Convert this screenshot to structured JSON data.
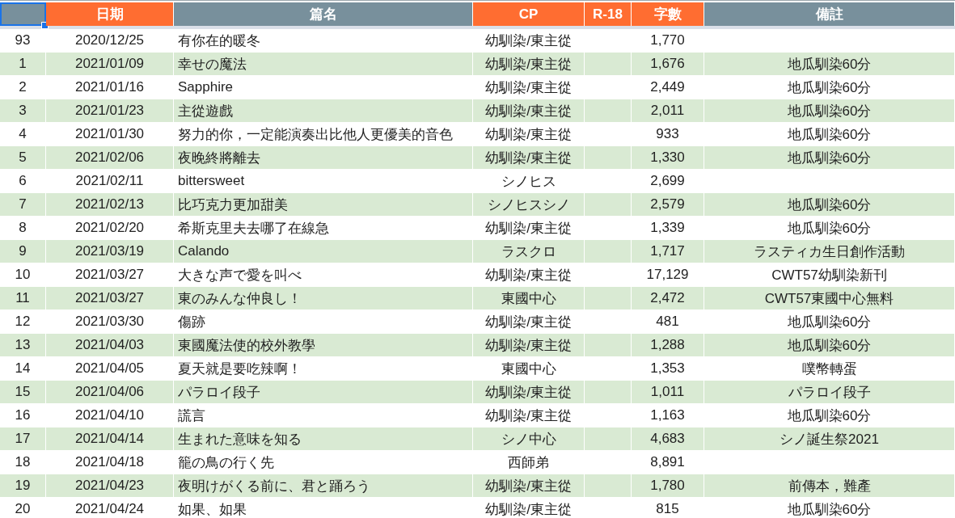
{
  "columns": [
    {
      "color": "#78909c",
      "selected": true
    },
    {
      "label": "日期",
      "color": "#ff6d31",
      "selected": false
    },
    {
      "label": "篇名",
      "color": "#78909c",
      "selected": false
    },
    {
      "label": "CP",
      "color": "#ff6d31",
      "selected": false
    },
    {
      "label": "R-18",
      "color": "#ff6d31",
      "selected": false
    },
    {
      "label": "字數",
      "color": "#ff6d31",
      "selected": false
    },
    {
      "label": "備註",
      "color": "#78909c",
      "selected": false
    }
  ],
  "rows": [
    {
      "no": "93",
      "date": "2020/12/25",
      "title": "有你在的暖冬",
      "cp": "幼馴染/東主從",
      "words": "1,770"
    },
    {
      "no": "1",
      "date": "2021/01/09",
      "title": "幸せの魔法",
      "cp": "幼馴染/東主從",
      "words": "1,676",
      "note": "地瓜馴染60分"
    },
    {
      "no": "2",
      "date": "2021/01/16",
      "title": "Sapphire",
      "cp": "幼馴染/東主從",
      "words": "2,449",
      "note": "地瓜馴染60分"
    },
    {
      "no": "3",
      "date": "2021/01/23",
      "title": "主從遊戲",
      "cp": "幼馴染/東主從",
      "words": "2,011",
      "note": "地瓜馴染60分"
    },
    {
      "no": "4",
      "date": "2021/01/30",
      "title": "努力的你，一定能演奏出比他人更優美的音色",
      "cp": "幼馴染/東主從",
      "words": "933",
      "note": "地瓜馴染60分"
    },
    {
      "no": "5",
      "date": "2021/02/06",
      "title": "夜晚終將離去",
      "cp": "幼馴染/東主從",
      "words": "1,330",
      "note": "地瓜馴染60分"
    },
    {
      "no": "6",
      "date": "2021/02/11",
      "title": "bittersweet",
      "cp": "シノヒス",
      "words": "2,699"
    },
    {
      "no": "7",
      "date": "2021/02/13",
      "title": "比巧克力更加甜美",
      "cp": "シノヒスシノ",
      "words": "2,579",
      "note": "地瓜馴染60分"
    },
    {
      "no": "8",
      "date": "2021/02/20",
      "title": "希斯克里夫去哪了在線急",
      "cp": "幼馴染/東主從",
      "words": "1,339",
      "note": "地瓜馴染60分"
    },
    {
      "no": "9",
      "date": "2021/03/19",
      "title": "Calando",
      "cp": "ラスクロ",
      "words": "1,717",
      "note": "ラスティカ生日創作活動"
    },
    {
      "no": "10",
      "date": "2021/03/27",
      "title": "大きな声で愛を叫べ",
      "cp": "幼馴染/東主從",
      "words": "17,129",
      "note": "CWT57幼馴染新刊"
    },
    {
      "no": "11",
      "date": "2021/03/27",
      "title": "東のみんな仲良し！",
      "cp": "東國中心",
      "words": "2,472",
      "note": "CWT57東國中心無料"
    },
    {
      "no": "12",
      "date": "2021/03/30",
      "title": "傷跡",
      "cp": "幼馴染/東主從",
      "words": "481",
      "note": "地瓜馴染60分"
    },
    {
      "no": "13",
      "date": "2021/04/03",
      "title": "東國魔法使的校外教學",
      "cp": "幼馴染/東主從",
      "words": "1,288",
      "note": "地瓜馴染60分"
    },
    {
      "no": "14",
      "date": "2021/04/05",
      "title": "夏天就是要吃辣啊！",
      "cp": "東國中心",
      "words": "1,353",
      "note": "噗幣轉蛋"
    },
    {
      "no": "15",
      "date": "2021/04/06",
      "title": "パラロイ段子",
      "cp": "幼馴染/東主從",
      "words": "1,011",
      "note": "パラロイ段子"
    },
    {
      "no": "16",
      "date": "2021/04/10",
      "title": "謊言",
      "cp": "幼馴染/東主從",
      "words": "1,163",
      "note": "地瓜馴染60分"
    },
    {
      "no": "17",
      "date": "2021/04/14",
      "title": "生まれた意味を知る",
      "cp": "シノ中心",
      "words": "4,683",
      "note": "シノ誕生祭2021"
    },
    {
      "no": "18",
      "date": "2021/04/18",
      "title": "籠の鳥の行く先",
      "cp": "西師弟",
      "words": "8,891"
    },
    {
      "no": "19",
      "date": "2021/04/23",
      "title": "夜明けがくる前に、君と踊ろう",
      "cp": "幼馴染/東主從",
      "words": "1,780",
      "note": "前傳本，難產"
    },
    {
      "no": "20",
      "date": "2021/04/24",
      "title": "如果、如果",
      "cp": "幼馴染/東主從",
      "words": "815",
      "note": "地瓜馴染60分"
    }
  ]
}
